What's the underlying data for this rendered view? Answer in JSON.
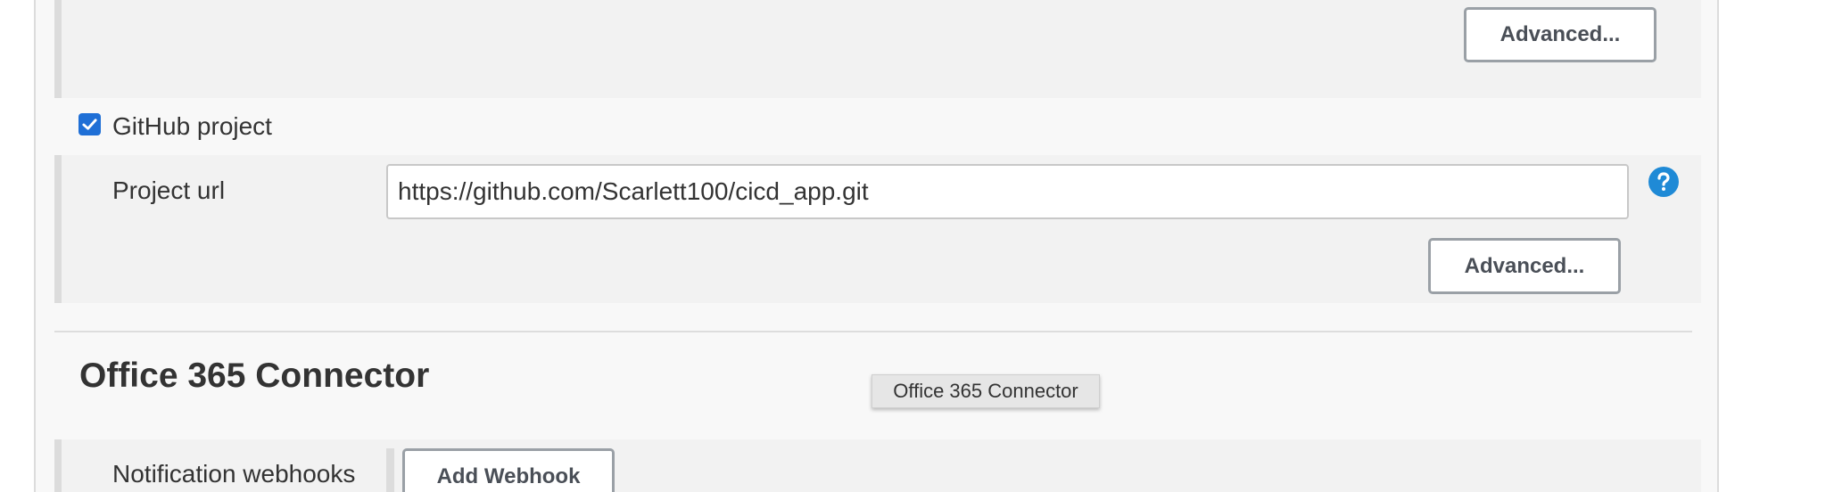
{
  "top_section": {
    "advanced_label": "Advanced..."
  },
  "github_project": {
    "checkbox_label": "GitHub project",
    "checked": true,
    "project_url_label": "Project url",
    "project_url_value": "https://github.com/Scarlett100/cicd_app.git",
    "advanced_label": "Advanced..."
  },
  "office365": {
    "section_title": "Office 365 Connector",
    "tooltip": "Office 365 Connector",
    "notification_webhooks_label": "Notification webhooks",
    "add_webhook_label": "Add Webhook"
  },
  "icons": {
    "checkbox": "check-icon",
    "help": "help-icon"
  },
  "colors": {
    "accent": "#1f6fd6",
    "help_icon": "#1f8ad6",
    "button_border": "#9aa0a6"
  }
}
